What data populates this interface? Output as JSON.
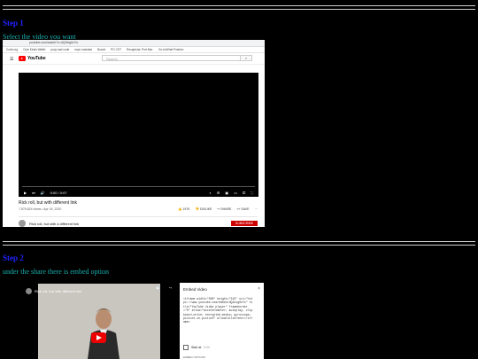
{
  "step1": {
    "label": "Step 1",
    "desc": "Select the video you want"
  },
  "step2": {
    "label": "Step 2",
    "desc": "under the share there is embed option"
  },
  "browser": {
    "url": "youtube.com/watch?v=dQ2eig0vYs",
    "bookmarks": [
      "Code.org",
      "Cute Kinds Wallet",
      "poop sad code",
      "expo evaluate",
      "Boxed",
      "PG CST",
      "Recaptcha: Port Mar.",
      "Go to/What Position"
    ]
  },
  "youtube": {
    "logo": "YouTube",
    "search_placeholder": "Search",
    "time": "0:00 / 0:07",
    "title": "Rick roll, but with different link",
    "meta": "7,876,824 views • Apr 30, 2020",
    "likes": "197K",
    "dislike": "DISLIKE",
    "share": "SHARE",
    "save": "SAVE",
    "channel_title": "Rick roll, but with a different link",
    "subscribe": "SUBSCRIBE"
  },
  "share_view": {
    "video_title": "Rick roll, but with different link",
    "watch_later": "Watch later",
    "share": "Share"
  },
  "embed": {
    "header": "Embed Video",
    "close": "×",
    "code": "<iframe width=\"560\" height=\"315\" src=\"https://www.youtube.com/embed/dQ2eig0vYs\" title=\"YouTube video player\" frameborder=\"0\" allow=\"accelerometer; autoplay; clipboard-write; encrypted-media; gyroscope; picture-in-picture\" allowfullscreen></iframe>",
    "start_label": "Start at",
    "start_value": "0:00",
    "options_label": "EMBED OPTIONS"
  }
}
